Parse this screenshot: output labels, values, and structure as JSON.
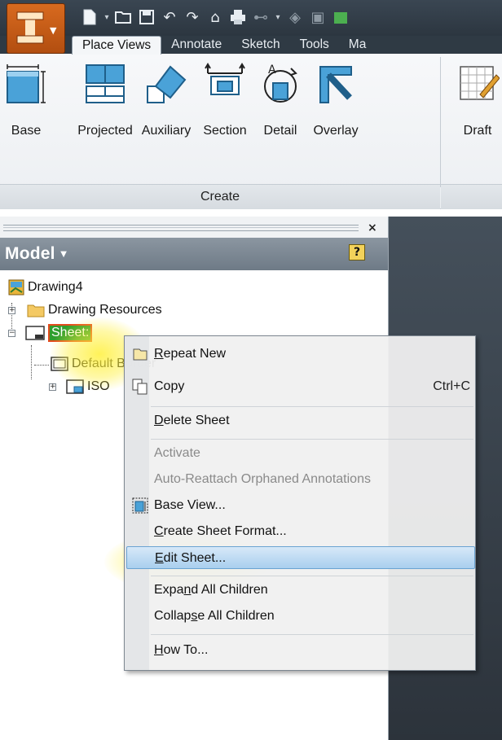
{
  "app": {
    "name": "Autodesk Inventor",
    "accent": "#d0601a"
  },
  "quick_access": {
    "icons": [
      "new-icon",
      "dropdown-icon",
      "open-icon",
      "save-icon",
      "undo-icon",
      "redo-icon",
      "home-icon",
      "print-icon",
      "measure-icon",
      "dropdown-icon",
      "appearance-icon",
      "update-icon",
      "material-icon"
    ]
  },
  "tabs": [
    {
      "label": "Place Views",
      "active": true
    },
    {
      "label": "Annotate",
      "active": false
    },
    {
      "label": "Sketch",
      "active": false
    },
    {
      "label": "Tools",
      "active": false
    },
    {
      "label": "Ma",
      "active": false
    }
  ],
  "ribbon": {
    "buttons": [
      {
        "label": "Base",
        "icon": "base-view-icon"
      },
      {
        "label": "Projected",
        "icon": "projected-view-icon"
      },
      {
        "label": "Auxiliary",
        "icon": "auxiliary-view-icon"
      },
      {
        "label": "Section",
        "icon": "section-view-icon"
      },
      {
        "label": "Detail",
        "icon": "detail-view-icon"
      },
      {
        "label": "Overlay",
        "icon": "overlay-view-icon"
      },
      {
        "label": "Draft",
        "icon": "draft-view-icon"
      }
    ],
    "panel_label": "Create"
  },
  "browser": {
    "title": "Model",
    "tree": [
      {
        "label": "Drawing4",
        "icon": "drawing-icon"
      },
      {
        "label": "Drawing Resources",
        "icon": "folder-icon",
        "expander": "+"
      },
      {
        "label": "Sheet:1",
        "icon": "sheet-icon",
        "expander": "−",
        "highlight_label": "Sheet:"
      },
      {
        "label": "Default Border",
        "icon": "border-icon"
      },
      {
        "label": "ISO",
        "icon": "title-block-icon",
        "expander": "+"
      }
    ]
  },
  "context_menu": {
    "items": [
      {
        "label": "Repeat New",
        "u": "R",
        "rest": "epeat New",
        "icon": "repeat-new-icon"
      },
      {
        "label": "Copy",
        "shortcut": "Ctrl+C",
        "icon": "copy-icon"
      },
      {
        "label": "Delete Sheet",
        "u": "D",
        "rest": "elete Sheet"
      },
      {
        "label": "Activate",
        "disabled": true
      },
      {
        "label": "Auto-Reattach Orphaned Annotations",
        "disabled": true
      },
      {
        "label": "Base View...",
        "icon": "base-view-icon"
      },
      {
        "label": "Create Sheet Format...",
        "u": "C",
        "rest": "reate Sheet Format..."
      },
      {
        "label": "Edit Sheet...",
        "u": "E",
        "rest": "dit Sheet...",
        "hover": true
      },
      {
        "label": "Expand All Children",
        "pre": "Expa",
        "u": "n",
        "rest": "d All Children"
      },
      {
        "label": "Collapse All Children",
        "pre": "Collap",
        "u": "s",
        "rest": "e All Children"
      },
      {
        "label": "How To...",
        "u": "H",
        "rest": "ow To..."
      }
    ]
  }
}
